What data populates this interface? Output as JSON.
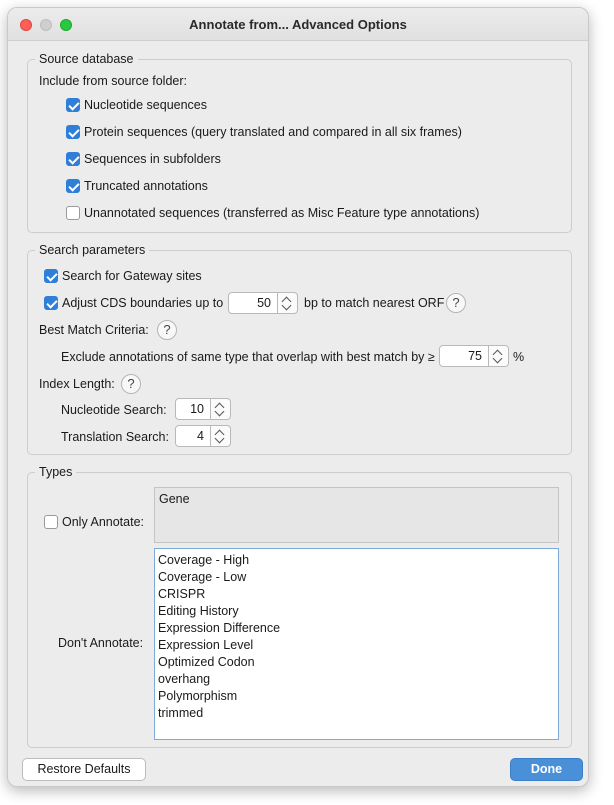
{
  "window": {
    "title": "Annotate from... Advanced Options"
  },
  "source_database": {
    "legend": "Source database",
    "include_label": "Include from source folder:",
    "options": [
      {
        "label": "Nucleotide sequences",
        "checked": true
      },
      {
        "label": "Protein sequences (query translated and compared in all six frames)",
        "checked": true
      },
      {
        "label": "Sequences in subfolders",
        "checked": true
      },
      {
        "label": "Truncated annotations",
        "checked": true
      },
      {
        "label": "Unannotated sequences (transferred as Misc Feature type annotations)",
        "checked": false
      }
    ]
  },
  "search_parameters": {
    "legend": "Search parameters",
    "gateway_label": "Search for Gateway sites",
    "gateway_checked": true,
    "adjust_cds_label": "Adjust CDS boundaries up to",
    "adjust_cds_checked": true,
    "adjust_cds_value": "50",
    "adjust_cds_suffix": "bp to match nearest ORF",
    "help_glyph": "?",
    "best_match_label": "Best Match Criteria:",
    "exclude_label": "Exclude annotations of same type that overlap with best match by ≥",
    "exclude_value": "75",
    "exclude_unit": "%",
    "index_length_label": "Index Length:",
    "nucleotide_search_label": "Nucleotide Search:",
    "nucleotide_search_value": "10",
    "translation_search_label": "Translation Search:",
    "translation_search_value": "4"
  },
  "types": {
    "legend": "Types",
    "only_annotate_label": "Only Annotate:",
    "only_annotate_checked": false,
    "only_annotate_text": "Gene",
    "dont_annotate_label": "Don't Annotate:",
    "dont_annotate_items": [
      "Coverage - High",
      "Coverage - Low",
      "CRISPR",
      "Editing History",
      "Expression Difference",
      "Expression Level",
      "Optimized Codon",
      "overhang",
      "Polymorphism",
      "trimmed"
    ]
  },
  "footer": {
    "restore_label": "Restore Defaults",
    "done_label": "Done"
  },
  "colors": {
    "accent": "#2f7ed8",
    "primary_button": "#4a90d9",
    "close": "#ff5f57",
    "zoom": "#28c840"
  }
}
